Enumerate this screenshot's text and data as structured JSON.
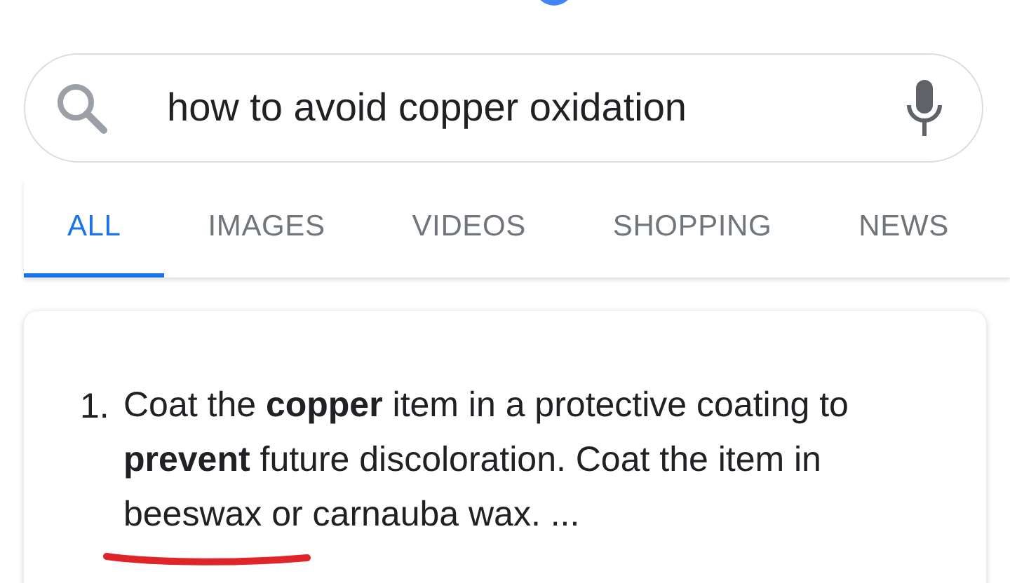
{
  "search": {
    "value": "how to avoid copper oxidation"
  },
  "tabs": [
    {
      "label": "ALL",
      "selected": true
    },
    {
      "label": "IMAGES",
      "selected": false
    },
    {
      "label": "VIDEOS",
      "selected": false
    },
    {
      "label": "SHOPPING",
      "selected": false
    },
    {
      "label": "NEWS",
      "selected": false
    }
  ],
  "result": {
    "items": [
      {
        "number": "1.",
        "text": "Coat the **copper** item in a protective coating to **prevent** future discoloration. Coat the item in beeswax or carnauba wax. ..."
      }
    ]
  }
}
